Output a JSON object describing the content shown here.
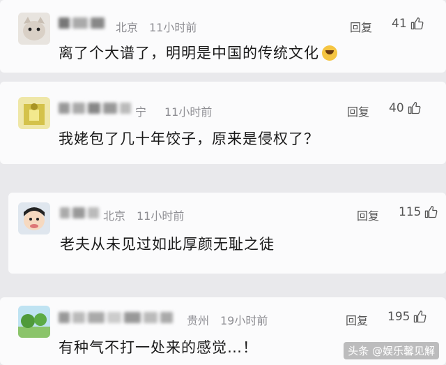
{
  "comments": [
    {
      "location": "北京",
      "time": "11小时前",
      "reply": "回复",
      "likes": "41",
      "text": "离了个大谱了，明明是中国的传统文化",
      "emoji": "laughing-crying-emoji"
    },
    {
      "location": "宁",
      "time": "11小时前",
      "reply": "回复",
      "likes": "40",
      "text": "我姥包了几十年饺子，原来是侵权了？"
    },
    {
      "location": "北京",
      "time": "11小时前",
      "reply": "回复",
      "likes": "115",
      "text": "老夫从未见过如此厚颜无耻之徒"
    },
    {
      "location": "贵州",
      "time": "19小时前",
      "reply": "回复",
      "likes": "195",
      "text": "有种气不打一处来的感觉…！"
    }
  ],
  "watermark": "头条 @娱乐馨见解",
  "icons": [
    "thumb-up-icon"
  ]
}
